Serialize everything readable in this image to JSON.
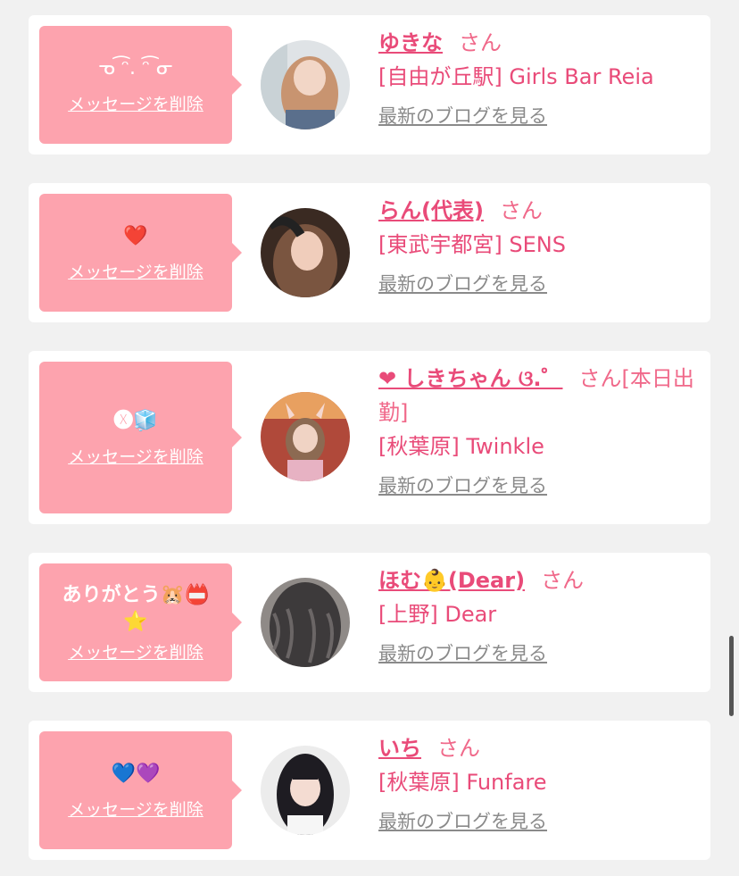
{
  "delete_label": "メッセージを削除",
  "blog_label": "最新のブログを見る",
  "colors": {
    "bubble": "#fda3ae",
    "name": "#e94b79",
    "honorific": "#f0698a",
    "link_gray": "#8a8a8a",
    "background": "#f1f1f1"
  },
  "cards": [
    {
      "message": "ᓀ ͡ᵔ. ᵔ͡ ᓂ",
      "name": "ゆきな",
      "honorific": "さん",
      "shop": "[自由が丘駅] Girls Bar Reia"
    },
    {
      "message": "❤️",
      "name": "らん(代表)",
      "honorific": "さん",
      "shop": "[東武宇都宮] SENS"
    },
    {
      "message": "🅧🧊",
      "name": "❤ しきちゃん ଓ.゜",
      "honorific": "さん[本日出勤]",
      "shop": "[秋葉原] Twinkle"
    },
    {
      "message": "ありがとう🐹📛⭐️",
      "name": "ほむ👶(Dear)",
      "honorific": "さん",
      "shop": "[上野] Dear"
    },
    {
      "message": "💙💜",
      "name": "いち",
      "honorific": "さん",
      "shop": "[秋葉原] Funfare"
    }
  ]
}
